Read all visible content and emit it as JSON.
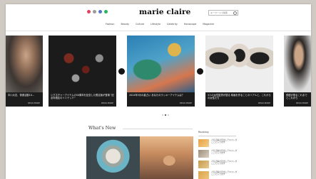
{
  "header": {
    "logo": "marie claire",
    "social_icons": [
      "instagram-icon",
      "x-icon",
      "facebook-icon",
      "line-icon"
    ],
    "social_colors": [
      "#e4405f",
      "#9a9a9a",
      "#4f77c8",
      "#2bb55a"
    ],
    "search_placeholder": "キーワードで検索"
  },
  "nav": {
    "items": [
      "Fashion",
      "Beauty",
      "Culture",
      "Lifestyle",
      "Celebrity",
      "Horoscope",
      "Magazine"
    ]
  },
  "carousel": {
    "cards": [
      {
        "caption": "中川大志、俳優活動10...",
        "more": "READ MORE"
      },
      {
        "caption": "シグネチャーアイテムの50周年を記念した限定版が登場 \"記念年限定のリミテッド\"",
        "more": "READ MORE"
      },
      {
        "caption": "2024年5月の星占い あなたのラッキーアイテムは？",
        "more": "READ MORE"
      },
      {
        "caption": "3人の女性監督が語る 映画を作ることのリアルと、これからの女性たち",
        "more": "READ MORE"
      },
      {
        "caption": "俳優が語るこれまでとこれから",
        "more": "READ MORE"
      }
    ],
    "dots_count": 3,
    "active_dot": 1
  },
  "whats_new": {
    "title": "What's New"
  },
  "ranking": {
    "title": "Ranking",
    "items": [
      {
        "text": "人気記事の見出しテキストがここに入ります"
      },
      {
        "text": "人気記事の見出しテキストがここに入ります"
      },
      {
        "text": "人気記事の見出しテキストがここに入ります"
      },
      {
        "text": "人気記事の見出しテキストがここに入ります"
      }
    ]
  },
  "colors": {
    "background": "#cfcac3",
    "page": "#ffffff",
    "caption_band": "#1c1c1c",
    "arrow": "#141414"
  }
}
